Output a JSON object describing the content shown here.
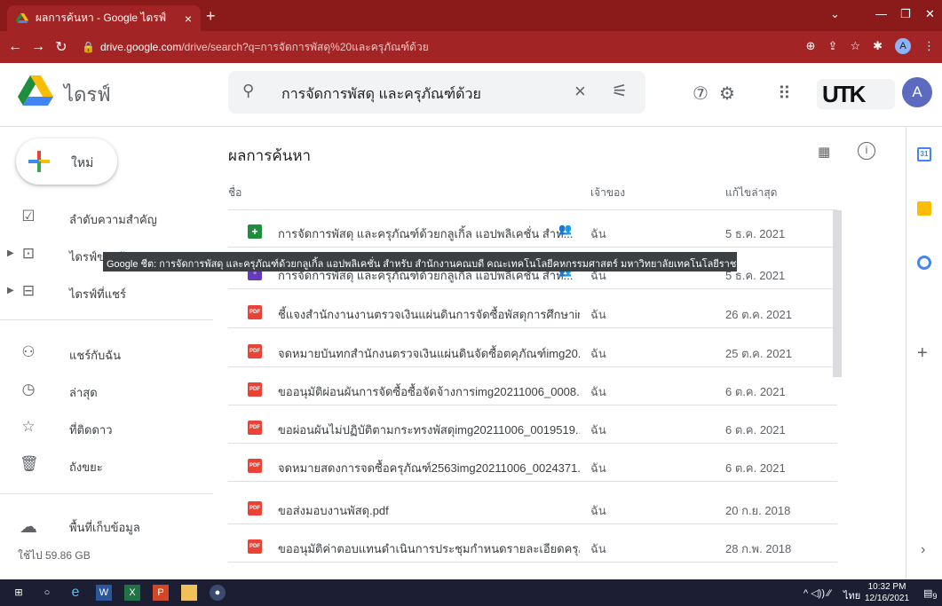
{
  "browser": {
    "tab_title": "ผลการค้นหา - Google ไดรฟ์",
    "url_host": "drive.google.com",
    "url_path": "/drive/search?q=การจัดการพัสดุ%20และครุภัณฑ์ด้วย",
    "profile_initial": "A"
  },
  "header": {
    "brand": "ไดรฟ์",
    "search_query": "การจัดการพัสดุ และครุภัณฑ์ด้วย",
    "org_logo": "UTK",
    "avatar_initial": "A"
  },
  "sidebar": {
    "new_label": "ใหม่",
    "items": [
      {
        "label": "ลำดับความสำคัญ",
        "icon": "priority-icon"
      },
      {
        "label": "ไดรฟ์ของฉัน",
        "icon": "my-drive-icon"
      },
      {
        "label": "ไดรฟ์ที่แชร์",
        "icon": "shared-drives-icon"
      },
      {
        "label": "แชร์กับฉัน",
        "icon": "shared-with-me-icon"
      },
      {
        "label": "ล่าสุด",
        "icon": "recent-icon"
      },
      {
        "label": "ที่ติดดาว",
        "icon": "starred-icon"
      },
      {
        "label": "ถังขยะ",
        "icon": "trash-icon"
      }
    ],
    "storage_label": "พื้นที่เก็บข้อมูล",
    "storage_used": "ใช้ไป 59.86 GB"
  },
  "main": {
    "title": "ผลการค้นหา",
    "col_name": "ชื่อ",
    "col_owner": "เจ้าของ",
    "col_modified": "แก้ไขล่าสุด",
    "rows": [
      {
        "type": "sheet",
        "name": "การจัดการพัสดุ และครุภัณฑ์ด้วยกลูเกิ้ล แอปพลิเคชั่น สำห...",
        "owner": "ฉัน",
        "modified": "5 ธ.ค. 2021",
        "shared": true
      },
      {
        "type": "form",
        "name": "การจัดการพัสดุ และครุภัณฑ์ด้วยกลูเกิ้ล แอปพลิเคชั่น สำห...",
        "owner": "ฉัน",
        "modified": "5 ธ.ค. 2021",
        "shared": true
      },
      {
        "type": "pdf",
        "name": "ชี้แจงสำนักงานงานตรวจเงินแผ่นดินการจัดซื้อพัสดุการศึกษาim...",
        "owner": "ฉัน",
        "modified": "26 ต.ค. 2021",
        "shared": false
      },
      {
        "type": "pdf",
        "name": "จดหมายบันทกสำนักงนตรวจเงินแผ่นดินจัดซื้อตคุภัณฑ์img20...",
        "owner": "ฉัน",
        "modified": "25 ต.ค. 2021",
        "shared": false
      },
      {
        "type": "pdf",
        "name": "ขออนุมัติผ่อนผันการจัดซื้อซื้อจัดจ้างการimg20211006_0008...",
        "owner": "ฉัน",
        "modified": "6 ต.ค. 2021",
        "shared": false
      },
      {
        "type": "pdf",
        "name": "ขอผ่อนผันไม่ปฏิบัติตามกระทรงพัสดุimg20211006_0019519...",
        "owner": "ฉัน",
        "modified": "6 ต.ค. 2021",
        "shared": false
      },
      {
        "type": "pdf",
        "name": "จดหมายสดงการจดซื้อครุภัณฑ์2563img20211006_0024371...",
        "owner": "ฉัน",
        "modified": "6 ต.ค. 2021",
        "shared": false
      },
      {
        "type": "pdf",
        "name": "ขอส่งมอบงานพัสดุ.pdf",
        "owner": "ฉัน",
        "modified": "20 ก.ย. 2018",
        "shared": false
      },
      {
        "type": "pdf",
        "name": "ขออนุมัติค่าตอบแทนดำเนินการประชุมกำหนดรายละเอียดครุภั...",
        "owner": "ฉัน",
        "modified": "28 ก.พ. 2018",
        "shared": false
      }
    ],
    "tooltip": "Google ชีต: การจัดการพัสดุ และครุภัณฑ์ด้วยกลูเกิ้ล แอปพลิเคชั่น สำหรับ สำนักงานคณบดี คณะเทคโนโลยีคหกรรมศาสตร์ มหาวิทยาลัยเทคโนโลยีราชมงคลกรุงเทพ"
  },
  "side_panel": {
    "calendar_day": "31"
  },
  "taskbar": {
    "lang": "ไทย",
    "time": "10:32 PM",
    "date": "12/16/2021",
    "notif_count": "9"
  },
  "colors": {
    "chrome_bg": "#8b1a1a",
    "chrome_bar": "#a22424",
    "pdf_red": "#ea4335",
    "sheet_green": "#1e8e3e",
    "form_purple": "#673ab7"
  }
}
